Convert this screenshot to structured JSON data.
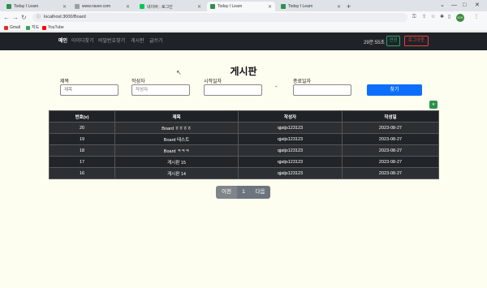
{
  "browser": {
    "tabs": [
      {
        "label": "Today I Learn",
        "favicon_color": "#2f8f4e",
        "active": false
      },
      {
        "label": "www.naver.com",
        "favicon_color": "#9aa0a6",
        "active": false
      },
      {
        "label": "네이버 : 로그인",
        "favicon_color": "#03c75a",
        "active": false
      },
      {
        "label": "Today I Learn",
        "favicon_color": "#2f8f4e",
        "active": true
      },
      {
        "label": "Today I Learn",
        "favicon_color": "#2f8f4e",
        "active": false
      }
    ],
    "new_tab": "+",
    "url": "localhost:3000/Board",
    "profile": "ICH",
    "bookmarks": [
      {
        "label": "Gmail",
        "icon_color": "#d93025"
      },
      {
        "label": "지도",
        "icon_color": "#34a853"
      },
      {
        "label": "YouTube",
        "icon_color": "#ff0000"
      }
    ]
  },
  "navbar": {
    "brand": "메인",
    "links": [
      "아이디찾기",
      "비밀번호찾기",
      "게시판",
      "글쓰기"
    ],
    "timer": "29분:55초",
    "extend_label": "연장",
    "logout_label": "로그아웃"
  },
  "page": {
    "title": "게시판",
    "filters": {
      "title_label": "제목",
      "title_placeholder": "제목",
      "author_label": "작성자",
      "author_placeholder": "작성자",
      "start_label": "시작일자",
      "end_label": "종료일자",
      "range_dash": "-",
      "search_label": "찾기"
    },
    "toggle_icon": "▾"
  },
  "table": {
    "headers": [
      "번호(v)",
      "제목",
      "작성자",
      "작성일"
    ],
    "rows": [
      [
        "20",
        "Board ㅎㅎㅎㅎ",
        "qjatjs123123",
        "2023-08-27"
      ],
      [
        "19",
        "Board 테스트",
        "qjatjs123123",
        "2023-08-27"
      ],
      [
        "18",
        "Board ㅋㅋㅋ",
        "qjatjs123123",
        "2023-08-27"
      ],
      [
        "17",
        "게시판 15",
        "qjatjs123123",
        "2023-08-27"
      ],
      [
        "16",
        "게시판 14",
        "qjatjs123123",
        "2023-08-27"
      ]
    ]
  },
  "pagination": {
    "prev": "이전",
    "page": "1",
    "next": "다음"
  }
}
